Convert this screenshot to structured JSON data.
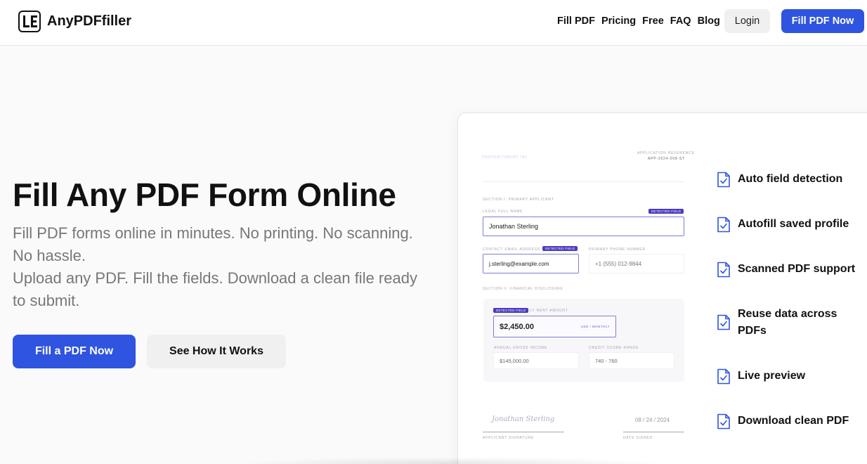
{
  "header": {
    "brand": "AnyPDFfiller",
    "nav": [
      "Fill PDF",
      "Pricing",
      "Free",
      "FAQ",
      "Blog"
    ],
    "login_label": "Login",
    "cta_label": "Fill PDF Now"
  },
  "hero": {
    "title": "Fill Any PDF Form Online",
    "subtitle_1": "Fill PDF forms online in minutes. No printing. No scanning. No hassle.",
    "subtitle_2": "Upload any PDF. Fill the fields. Download a clean file ready to submit.",
    "primary_button": "Fill a PDF Now",
    "secondary_button": "See How It Works"
  },
  "doc": {
    "company": "PROPERTYMGMT INC.",
    "app_ref_label": "APPLICATION REFERENCE",
    "app_ref_value": "APP-2024-008-ST",
    "section1": "SECTION I: PRIMARY APPLICANT",
    "legal_name_label": "LEGAL FULL NAME",
    "legal_name_value": "Jonathan Sterling",
    "email_label": "CONTACT EMAIL ADDRESS",
    "email_value": "j.sterling@example.com",
    "phone_label": "PRIMARY PHONE NUMBER",
    "phone_value": "+1 (555) 012-9844",
    "section2": "SECTION II: FINANCIAL DISCLOSURE",
    "rent_label": "LY RENT AMOUNT",
    "rent_value": "$2,450.00",
    "rent_unit": "USD / MONTHLY",
    "income_label": "ANNUAL GROSS INCOME",
    "income_value": "$145,000.00",
    "credit_label": "CREDIT SCORE RANGE",
    "credit_value": "740 - 760",
    "badge": "DETECTED FIELD",
    "signature": "Jonathan Sterling",
    "signature_label": "APPLICANT SIGNATURE",
    "date_value": "08 / 24 / 2024",
    "date_label": "DATE SIGNED"
  },
  "features": [
    {
      "label": "Auto field detection",
      "icon": "doc-check-icon"
    },
    {
      "label": "Autofill saved profile",
      "icon": "doc-check-icon"
    },
    {
      "label": "Scanned PDF support",
      "icon": "doc-check-icon"
    },
    {
      "label": "Reuse data across PDFs",
      "icon": "doc-check-icon"
    },
    {
      "label": "Live preview",
      "icon": "doc-check-icon"
    },
    {
      "label": "Download clean PDF",
      "icon": "doc-check-icon"
    }
  ],
  "colors": {
    "accent": "#2f54e0",
    "badge": "#4a3bbf",
    "icon": "#2f54e0"
  }
}
